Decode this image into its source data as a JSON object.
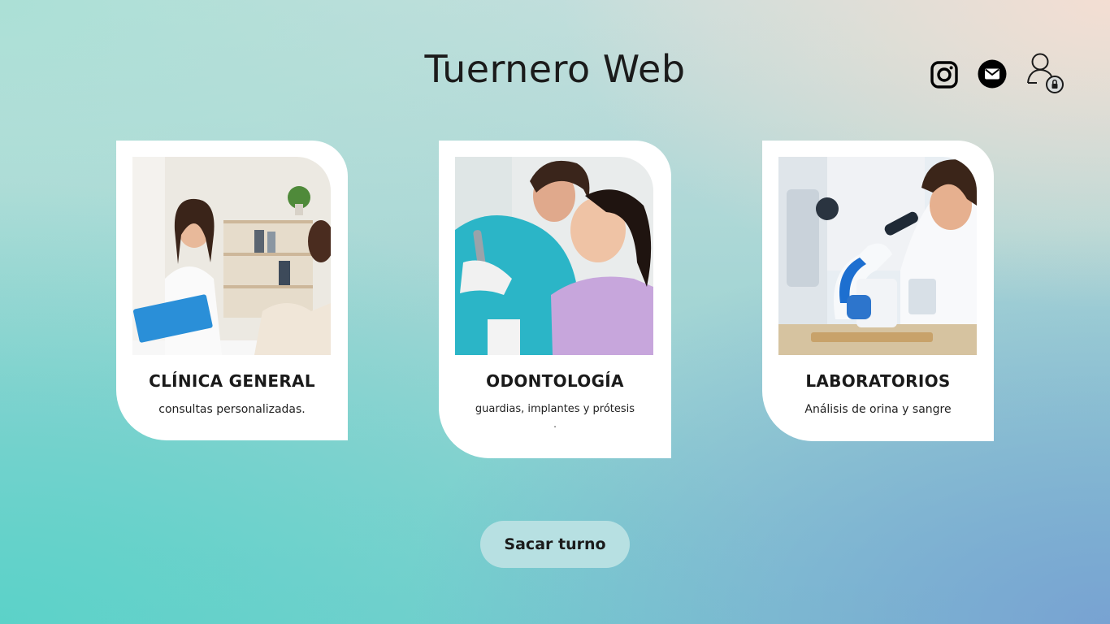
{
  "header": {
    "title": "Tuernero Web"
  },
  "social": {
    "instagram_icon": "instagram-icon",
    "mail_icon": "mail-icon",
    "user_icon": "user-lock-icon"
  },
  "cards": [
    {
      "title": "CLÍNICA GENERAL",
      "description": "consultas personalizadas.",
      "image": "doctor-consultation-photo"
    },
    {
      "title": "ODONTOLOGÍA",
      "description": "guardias,  implantes y prótesis",
      "extra": ".",
      "image": "dentist-patient-photo"
    },
    {
      "title": "LABORATORIOS",
      "description": "Análisis de orina y sangre",
      "image": "lab-microscope-photo"
    }
  ],
  "cta": {
    "label": "Sacar turno"
  },
  "colors": {
    "card": "#ffffff",
    "button": "#b7e0e2",
    "text": "#1b1b1b"
  }
}
